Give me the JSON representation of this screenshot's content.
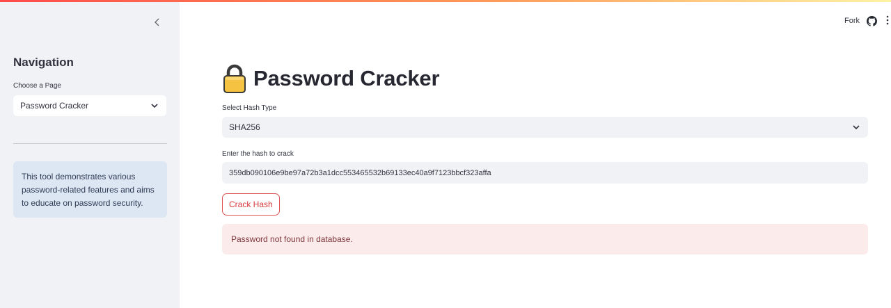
{
  "sidebar": {
    "nav_title": "Navigation",
    "choose_label": "Choose a Page",
    "selected_page": "Password Cracker",
    "info_text": "This tool demonstrates various password-related features and aims to educate on password security."
  },
  "header": {
    "fork_label": "Fork"
  },
  "main": {
    "title": "Password Cracker",
    "title_icon": "lock-icon",
    "hash_type_label": "Select Hash Type",
    "hash_type_value": "SHA256",
    "hash_input_label": "Enter the hash to crack",
    "hash_input_value": "359db090106e9be97a72b3a1dcc553465532b69133ec40a9f7123bbcf323affa",
    "crack_button_label": "Crack Hash",
    "result_message": "Password not found in database."
  },
  "colors": {
    "accent": "#ff4b4b",
    "sidebar_bg": "#f0f2f6",
    "info_bg": "#dde6f3",
    "error_bg": "#fcebeb"
  }
}
